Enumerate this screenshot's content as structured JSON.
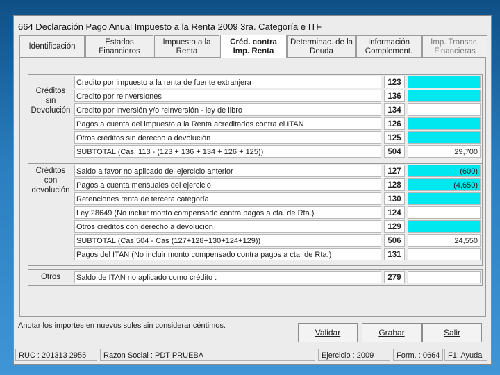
{
  "window": {
    "title": "664 Declaración Pago Anual Impuesto a la Renta 2009 3ra. Categoría e ITF"
  },
  "tabs": [
    {
      "line1": "Identificación",
      "line2": ""
    },
    {
      "line1": "Estados",
      "line2": "Financieros"
    },
    {
      "line1": "Impuesto a la",
      "line2": "Renta"
    },
    {
      "line1": "Créd. contra",
      "line2": "Imp. Renta"
    },
    {
      "line1": "Determinac. de la",
      "line2": "Deuda"
    },
    {
      "line1": "Información",
      "line2": "Complement."
    },
    {
      "line1": "Imp. Transac.",
      "line2": "Financieras"
    }
  ],
  "groups": {
    "sin_devolucion": {
      "label": [
        "Créditos",
        "sin",
        "Devolución"
      ],
      "rows": [
        {
          "desc": "Credito por impuesto a la renta de fuente extranjera",
          "code": "123",
          "value": ""
        },
        {
          "desc": "Credito por reinversiones",
          "code": "136",
          "value": ""
        },
        {
          "desc": "Credito por inversión y/o reinversión - ley de libro",
          "code": "134",
          "value": ""
        },
        {
          "desc": "Pagos a cuenta del impuesto a la Renta acreditados contra el ITAN",
          "code": "126",
          "value": ""
        },
        {
          "desc": "Otros créditos sin derecho a devolución",
          "code": "125",
          "value": ""
        },
        {
          "desc": "SUBTOTAL (Cas. 113 - (123 + 136 + 134 + 126 + 125))",
          "code": "504",
          "value": "29,700"
        }
      ]
    },
    "con_devolucion": {
      "label": [
        "Créditos",
        "con",
        "devolución"
      ],
      "rows": [
        {
          "desc": "Saldo a favor no aplicado del ejercicio anterior",
          "code": "127",
          "value": "(600)"
        },
        {
          "desc": "Pagos a cuenta mensuales del ejercicio",
          "code": "128",
          "value": "(4,650)"
        },
        {
          "desc": "Retenciones renta de tercera categoría",
          "code": "130",
          "value": ""
        },
        {
          "desc": "Ley 28649 (No incluir monto compensado contra pagos a cta. de Rta.)",
          "code": "124",
          "value": ""
        },
        {
          "desc": "Otros créditos con derecho a devolucion",
          "code": "129",
          "value": ""
        },
        {
          "desc": "SUBTOTAL (Cas 504 - Cas (127+128+130+124+129))",
          "code": "506",
          "value": "24,550"
        },
        {
          "desc": "Pagos del ITAN (No incluir monto compensado contra pagos a cta. de Rta.)",
          "code": "131",
          "value": ""
        }
      ]
    },
    "otros": {
      "label": [
        "Otros"
      ],
      "rows": [
        {
          "desc": "Saldo de ITAN no aplicado como crédito :",
          "code": "279",
          "value": ""
        }
      ]
    }
  },
  "footer": {
    "note": "Anotar los importes en nuevos soles sin considerar céntimos.",
    "validar": "Validar",
    "grabar": "Grabar",
    "salir": "Salir"
  },
  "status": {
    "ruc": "RUC : 201313  2955",
    "razon": "Razon Social : PDT PRUEBA",
    "ejercicio": "Ejercicio : 2009",
    "form": "Form. : 0664",
    "help": "F1: Ayuda"
  },
  "colors": {
    "editable": "#00e8ef",
    "background": "#1f6aa6"
  }
}
